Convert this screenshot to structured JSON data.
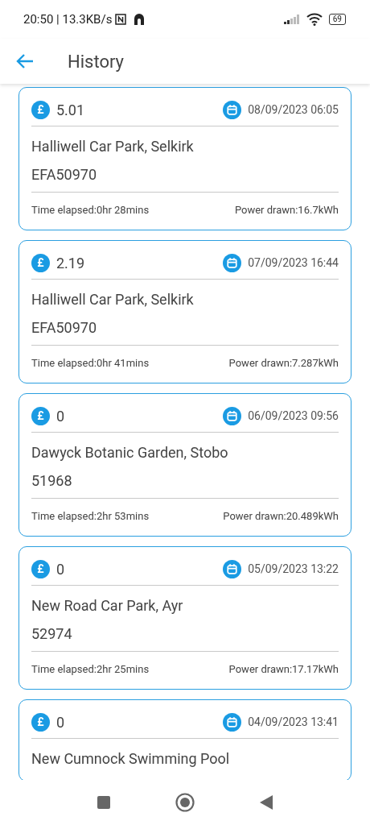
{
  "status_bar": {
    "time": "20:50 | 13.3KB/s",
    "battery": "69"
  },
  "header": {
    "title": "History"
  },
  "sessions": [
    {
      "currency": "£",
      "amount": "5.01",
      "datetime": "08/09/2023 06:05",
      "location": "Halliwell Car Park, Selkirk",
      "charger_id": "EFA50970",
      "time_elapsed": "Time elapsed:0hr 28mins",
      "power_drawn": "Power drawn:16.7kWh"
    },
    {
      "currency": "£",
      "amount": "2.19",
      "datetime": "07/09/2023 16:44",
      "location": "Halliwell Car Park, Selkirk",
      "charger_id": "EFA50970",
      "time_elapsed": "Time elapsed:0hr 41mins",
      "power_drawn": "Power drawn:7.287kWh"
    },
    {
      "currency": "£",
      "amount": "0",
      "datetime": "06/09/2023 09:56",
      "location": "Dawyck Botanic Garden, Stobo",
      "charger_id": "51968",
      "time_elapsed": "Time elapsed:2hr 53mins",
      "power_drawn": "Power drawn:20.489kWh"
    },
    {
      "currency": "£",
      "amount": "0",
      "datetime": "05/09/2023 13:22",
      "location": "New Road Car Park, Ayr",
      "charger_id": "52974",
      "time_elapsed": "Time elapsed:2hr 25mins",
      "power_drawn": "Power drawn:17.17kWh"
    },
    {
      "currency": "£",
      "amount": "0",
      "datetime": "04/09/2023 13:41",
      "location": "New Cumnock Swimming Pool"
    }
  ]
}
